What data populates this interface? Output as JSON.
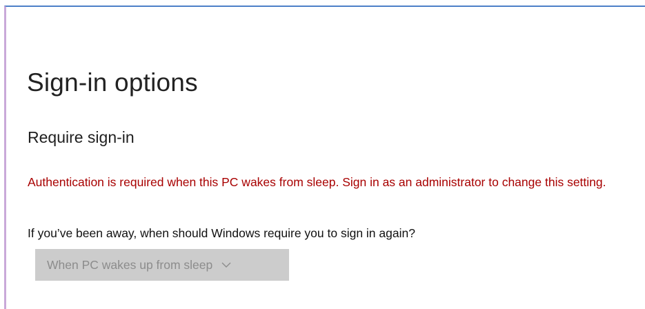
{
  "page": {
    "title": "Sign-in options"
  },
  "require_signin": {
    "heading": "Require sign-in",
    "warning": "Authentication is required when this PC wakes from sleep. Sign in as an administrator to change this setting.",
    "question": "If you’ve been away, when should Windows require you to sign in again?",
    "dropdown": {
      "selected": "When PC wakes up from sleep",
      "disabled": true,
      "icon": "chevron-down-icon"
    }
  },
  "colors": {
    "warning": "#a80000",
    "dropdown_bg": "#cccccc",
    "dropdown_text": "#8c8c8c",
    "frame_top": "#4c7fc7",
    "frame_left": "#c9a9d9"
  }
}
